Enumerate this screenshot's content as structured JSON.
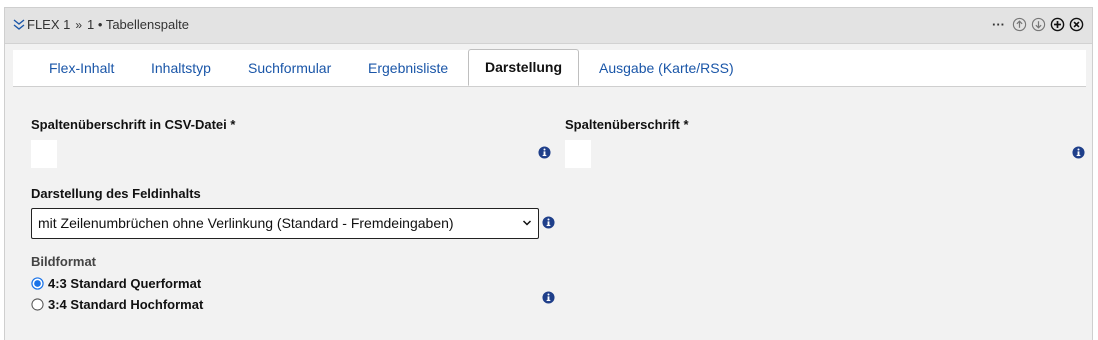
{
  "header": {
    "title": "FLEX 1",
    "separator": "»",
    "subtitle": "1 • Tabellenspalte",
    "more_label": "···"
  },
  "tabs": [
    {
      "label": "Flex-Inhalt",
      "active": false
    },
    {
      "label": "Inhaltstyp",
      "active": false
    },
    {
      "label": "Suchformular",
      "active": false
    },
    {
      "label": "Ergebnisliste",
      "active": false
    },
    {
      "label": "Darstellung",
      "active": true
    },
    {
      "label": "Ausgabe (Karte/RSS)",
      "active": false
    }
  ],
  "form": {
    "csv_heading_label": "Spaltenüberschrift in CSV-Datei *",
    "csv_heading_value": "",
    "heading_label": "Spaltenüberschrift *",
    "heading_value": "",
    "display_label": "Darstellung des Feldinhalts",
    "display_selected": "mit Zeilenumbrüchen ohne Verlinkung (Standard - Fremdeingaben)",
    "image_format_label": "Bildformat",
    "image_format_options": [
      {
        "label": "4:3 Standard Querformat",
        "checked": true
      },
      {
        "label": "3:4 Standard Hochformat",
        "checked": false
      }
    ]
  },
  "colors": {
    "accent": "#1a56a8",
    "info_icon": "#1f3f8a",
    "header_bg": "#e3e3e3",
    "content_bg": "#f2f2f2"
  },
  "icons": [
    "double-chevron-down-icon",
    "more-icon",
    "move-up-icon",
    "move-down-icon",
    "add-icon",
    "close-icon",
    "info-icon",
    "dropdown-caret-icon"
  ]
}
